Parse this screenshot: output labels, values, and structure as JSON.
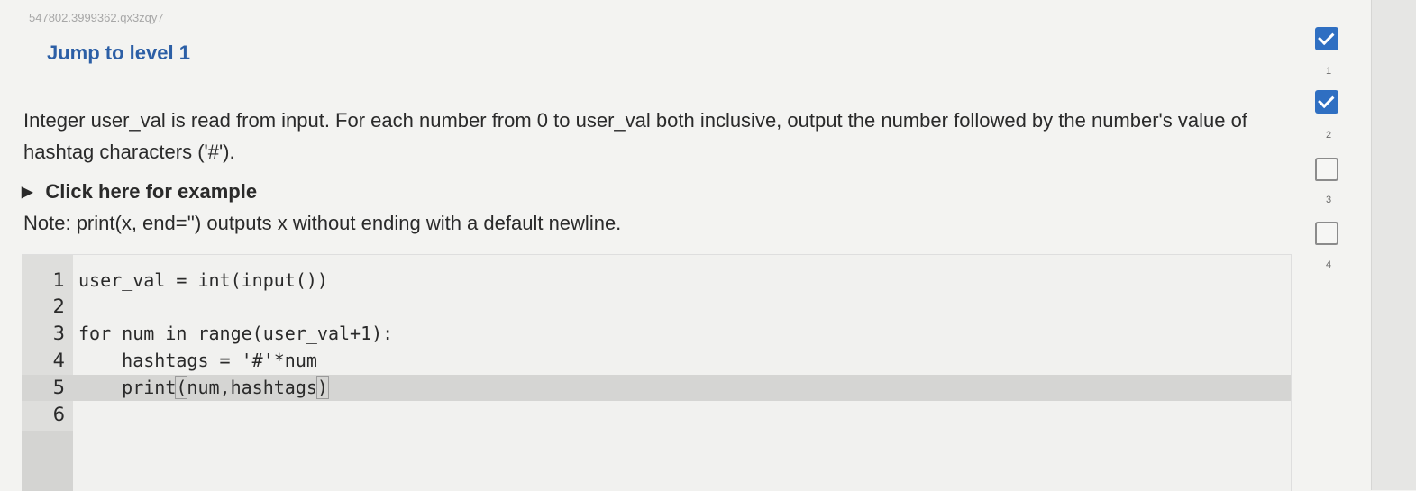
{
  "activity_id": "547802.3999362.qx3zqy7",
  "level_title": "Jump to level 1",
  "prompt_text": "Integer user_val is read from input. For each number from 0 to user_val both inclusive, output the number followed by the number's value of hashtag characters ('#').",
  "example_toggle": {
    "label": "Click here for example",
    "icon": "triangle-right-icon"
  },
  "note_text": "Note: print(x, end='') outputs x without ending with a default newline.",
  "editor": {
    "active_line": 5,
    "lines": [
      {
        "num": "1",
        "code": "user_val = int(input())"
      },
      {
        "num": "2",
        "code": ""
      },
      {
        "num": "3",
        "code": "for num in range(user_val+1):"
      },
      {
        "num": "4",
        "code": "    hashtags = '#'*num"
      },
      {
        "num": "5",
        "code_before": "    print",
        "paren_open": "(",
        "code_mid": "num,hashtags",
        "paren_close": ")"
      },
      {
        "num": "6",
        "code": ""
      }
    ]
  },
  "levels": [
    {
      "num": "1",
      "status": "completed",
      "icon": "checkmark-icon"
    },
    {
      "num": "2",
      "status": "completed",
      "icon": "checkmark-icon"
    },
    {
      "num": "3",
      "status": "incomplete"
    },
    {
      "num": "4",
      "status": "incomplete"
    }
  ],
  "colors": {
    "accent": "#2f6fc2",
    "title": "#2c5fa6",
    "active_line": "#d5d5d3"
  }
}
